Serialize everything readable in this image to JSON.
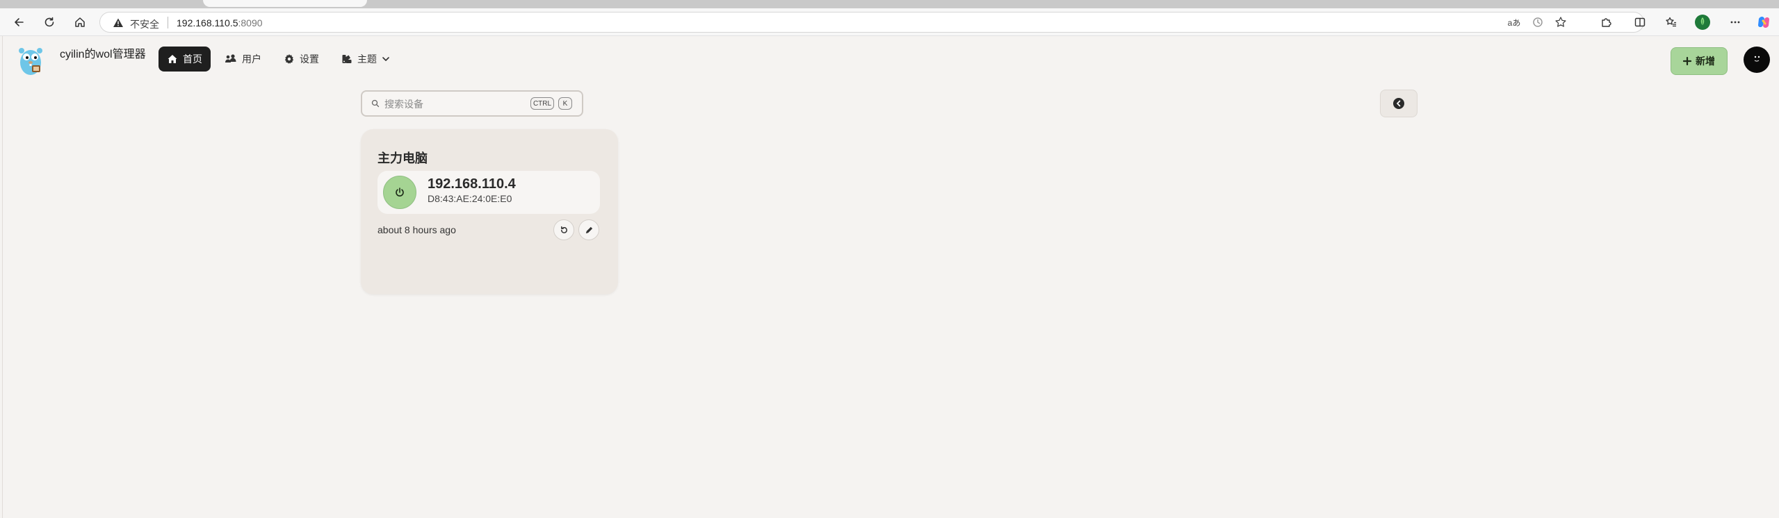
{
  "browser": {
    "security_label": "不安全",
    "url_host": "192.168.110.5",
    "url_port": ":8090",
    "read_aloud_label": "aあ"
  },
  "app": {
    "title": "cyilin的wol管理器",
    "nav": [
      {
        "label": "首页",
        "icon": "home-icon",
        "active": true
      },
      {
        "label": "用户",
        "icon": "users-icon",
        "active": false
      },
      {
        "label": "设置",
        "icon": "gear-icon",
        "active": false
      },
      {
        "label": "主题",
        "icon": "palette-icon",
        "active": false
      }
    ],
    "add_button_label": "新增",
    "accent_color": "#a8d59a"
  },
  "search": {
    "placeholder": "搜索设备",
    "shortcut_keys": [
      "CTRL",
      "K"
    ]
  },
  "devices": [
    {
      "name": "主力电脑",
      "ip": "192.168.110.4",
      "mac": "D8:43:AE:24:0E:E0",
      "last_seen": "about 8 hours ago"
    }
  ]
}
